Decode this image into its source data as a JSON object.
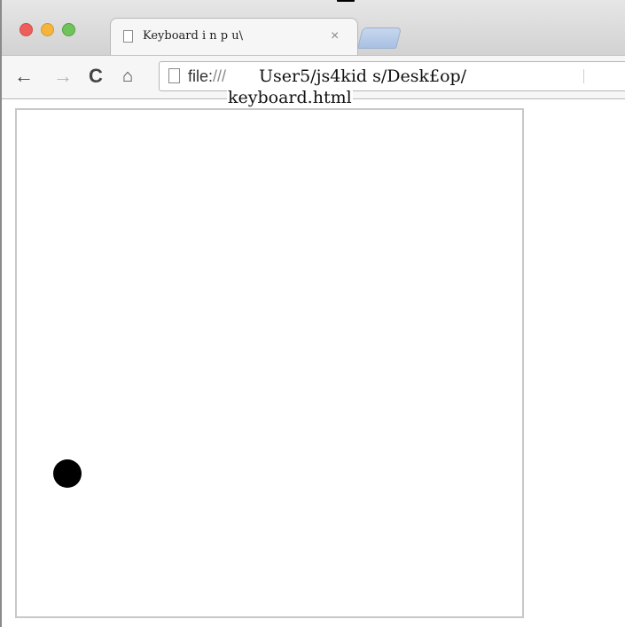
{
  "browser": {
    "tab": {
      "title": "Keyboard  i n p u\\",
      "close_glyph": "×"
    },
    "nav": {
      "back_glyph": "←",
      "forward_glyph": "→",
      "reload_glyph": "C",
      "home_glyph": "⌂"
    },
    "address": {
      "scheme": "file:",
      "slashes": "///",
      "path": "User5/js4kid s/Desk£op/",
      "path_overflow": "keyboard.html"
    }
  },
  "colors": {
    "close": "#ee5f5b",
    "minimize": "#f5b43b",
    "zoom": "#6fc35a",
    "new_tab": "#b3c7e6",
    "ball": "#000000",
    "canvas_border": "#c8c8c8"
  },
  "icons": [
    "close-dot-icon",
    "minimize-dot-icon",
    "zoom-dot-icon",
    "document-icon",
    "close-icon",
    "back-arrow-icon",
    "forward-arrow-icon",
    "reload-icon",
    "home-icon"
  ]
}
